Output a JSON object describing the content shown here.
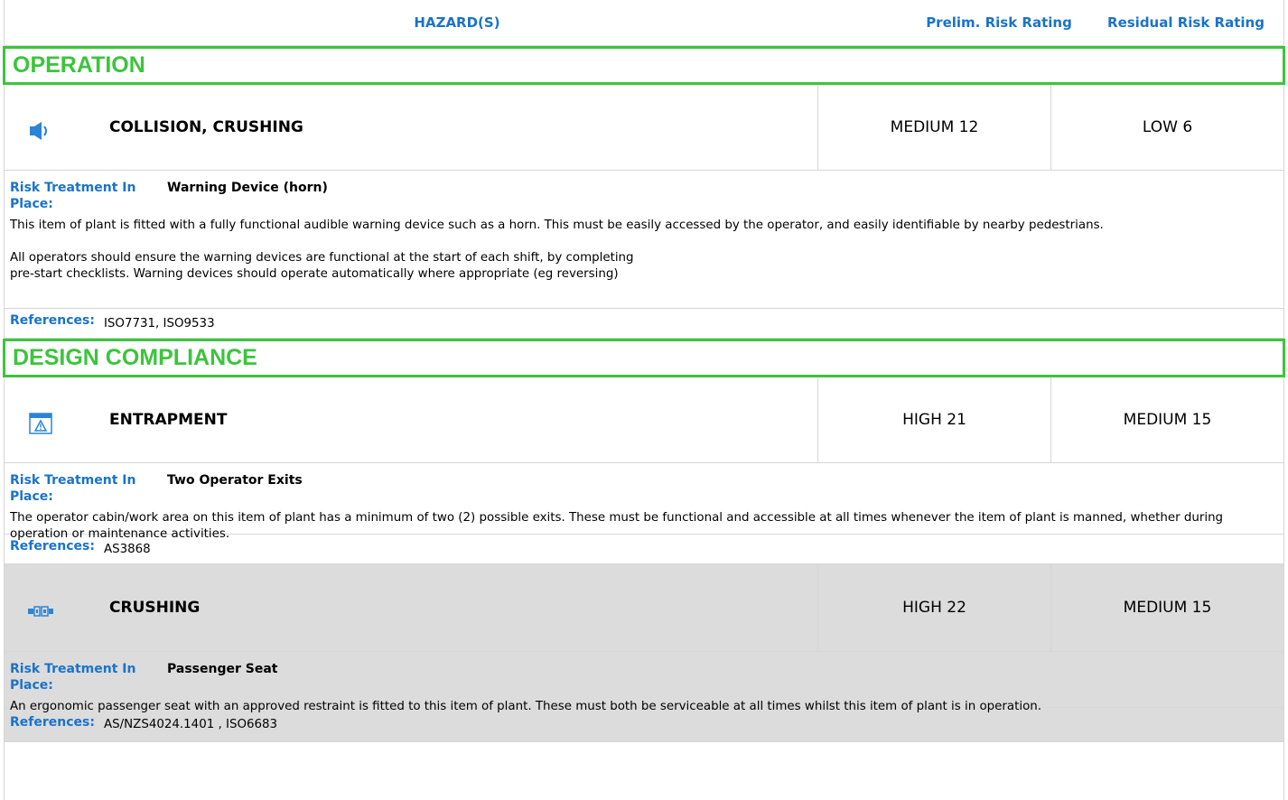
{
  "header": {
    "hazards": "HAZARD(S)",
    "prelim": "Prelim. Risk Rating",
    "residual": "Residual Risk Rating"
  },
  "sections": [
    {
      "title": "OPERATION",
      "hazards": [
        {
          "icon": "speaker-icon",
          "title": "COLLISION, CRUSHING",
          "prelim": "MEDIUM 12",
          "residual": "LOW 6",
          "treatment_label": "Risk Treatment In Place:",
          "treatment_name": "Warning Device (horn)",
          "paragraph1": "This item of plant is fitted with a fully functional audible warning device such as a horn. This must be easily accessed by the operator, and easily identifiable by nearby pedestrians.",
          "paragraph2_line1": "All operators should ensure the warning devices are functional at the start of each shift, by completing",
          "paragraph2_line2": "pre-start checklists. Warning devices should operate automatically where appropriate (eg reversing)",
          "references_label": "References:",
          "references": "ISO7731, ISO9533"
        }
      ]
    },
    {
      "title": "DESIGN COMPLIANCE",
      "hazards": [
        {
          "icon": "warning-window-icon",
          "title": "ENTRAPMENT",
          "prelim": "HIGH 21",
          "residual": "MEDIUM 15",
          "treatment_label": "Risk Treatment In Place:",
          "treatment_name": "Two Operator Exits",
          "paragraph1": "The operator cabin/work area on this item of plant has a minimum of two (2) possible exits. These must be functional and accessible at all times whenever the item of plant is manned, whether during operation or maintenance activities.",
          "references_label": "References:",
          "references": "AS3868"
        },
        {
          "icon": "seatbelt-icon",
          "title": "CRUSHING",
          "prelim": "HIGH 22",
          "residual": "MEDIUM 15",
          "treatment_label": "Risk Treatment In Place:",
          "treatment_name": "Passenger Seat",
          "paragraph1": "An ergonomic passenger seat with an approved restraint is fitted to this item of plant. These must both be serviceable at all times whilst this item of plant is in operation.",
          "references_label": "References:",
          "references": "AS/NZS4024.1401 , ISO6683"
        }
      ]
    }
  ],
  "colors": {
    "accent_blue": "#1a73c9",
    "section_green": "#3cc43c",
    "shaded_row": "#dcdcdc",
    "icon_blue": "#2b84d6"
  }
}
